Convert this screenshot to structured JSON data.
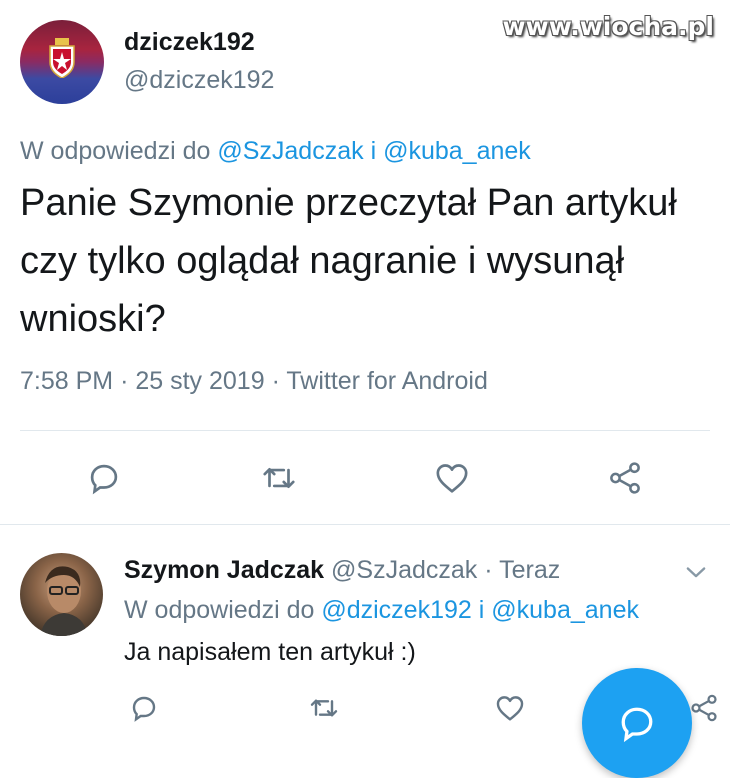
{
  "watermark": "www.wiocha.pl",
  "main_tweet": {
    "display_name": "dziczek192",
    "handle": "@dziczek192",
    "reply_prefix": "W odpowiedzi do",
    "mention_1": "@SzJadczak",
    "conjunction": "i",
    "mention_2": "@kuba_anek",
    "text": "Panie Szymonie przeczytał Pan artykuł czy tylko oglądał nagranie i wysunął wnioski?",
    "time": "7:58 PM",
    "date": "25 sty 2019",
    "source": "Twitter for Android",
    "separator": "·"
  },
  "reply_tweet": {
    "display_name": "Szymon Jadczak",
    "handle": "@SzJadczak",
    "separator": "·",
    "time": "Teraz",
    "reply_prefix": "W odpowiedzi do",
    "mention_1": "@dziczek192",
    "conjunction": "i",
    "mention_2": "@kuba_anek",
    "text": "Ja napisałem ten artykuł :)"
  },
  "icons": {
    "reply": "reply-icon",
    "retweet": "retweet-icon",
    "like": "heart-icon",
    "share": "share-icon",
    "chevron": "chevron-down-icon",
    "compose": "compose-reply-icon"
  },
  "colors": {
    "accent": "#1da1f2",
    "mention": "#1b95e0",
    "secondary_text": "#657786",
    "icon": "#657786"
  }
}
